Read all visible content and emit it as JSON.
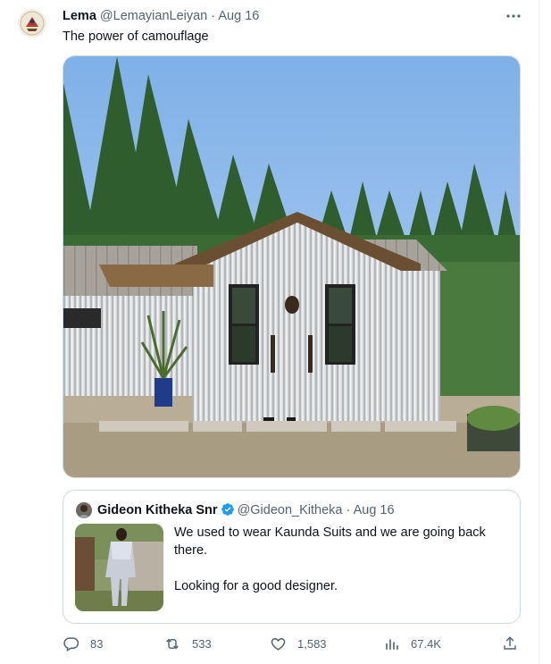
{
  "tweet": {
    "author_name": "Lema",
    "author_handle": "@LemayianLeiyan",
    "separator": "·",
    "date": "Aug 16",
    "text": "The power of camouflage"
  },
  "quote": {
    "author_name": "Gideon Kitheka Snr",
    "author_handle": "@Gideon_Kitheka",
    "separator": "·",
    "date": "Aug 16",
    "line1": "We used to wear Kaunda Suits and we are going back there.",
    "line2": "Looking for a good designer.",
    "verified": true
  },
  "actions": {
    "replies": "83",
    "retweets": "533",
    "likes": "1,583",
    "views": "67.4K"
  },
  "icons": [
    "more-icon",
    "verified-icon",
    "reply-icon",
    "retweet-icon",
    "like-icon",
    "views-icon",
    "share-icon"
  ],
  "colors": {
    "text": "#0f1419",
    "secondary": "#536471",
    "verified": "#1d9bf0",
    "border": "#cfd9de"
  }
}
